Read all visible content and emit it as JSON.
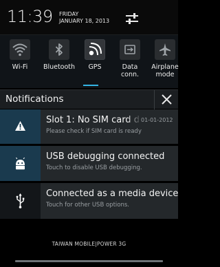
{
  "status_bar": {
    "time": "11:39",
    "day": "FRIDAY",
    "date": "JANUARY 18, 2013"
  },
  "quick_toggles": [
    {
      "label": "Wi-Fi",
      "icon": "wifi-icon",
      "on": false
    },
    {
      "label": "Bluetooth",
      "icon": "bluetooth-icon",
      "on": false
    },
    {
      "label": "GPS",
      "icon": "gps-icon",
      "on": true
    },
    {
      "label_lines": [
        "Data",
        "conn."
      ],
      "icon": "data-connection-icon",
      "on": false
    },
    {
      "label_lines": [
        "Airplane",
        "mode"
      ],
      "icon": "airplane-icon",
      "on": false
    }
  ],
  "notifications_header": {
    "title": "Notifications"
  },
  "notifications": [
    {
      "title": "Slot 1: No SIM card d",
      "subtitle": "Please check if SIM card is ready",
      "time": "01-01-2012",
      "icon": "warning-icon"
    },
    {
      "title": "USB debugging connected",
      "subtitle": "Touch to disable USB debugging.",
      "icon": "android-icon"
    },
    {
      "title": "Connected as a media device",
      "subtitle": "Touch for other USB options.",
      "icon": "usb-icon"
    }
  ],
  "carrier": "TAIWAN MOBILE|POWER 3G",
  "colors": {
    "accent": "#33b5e5",
    "panel": "#24282b",
    "icon_panel_blue": "#1a3a4e"
  }
}
